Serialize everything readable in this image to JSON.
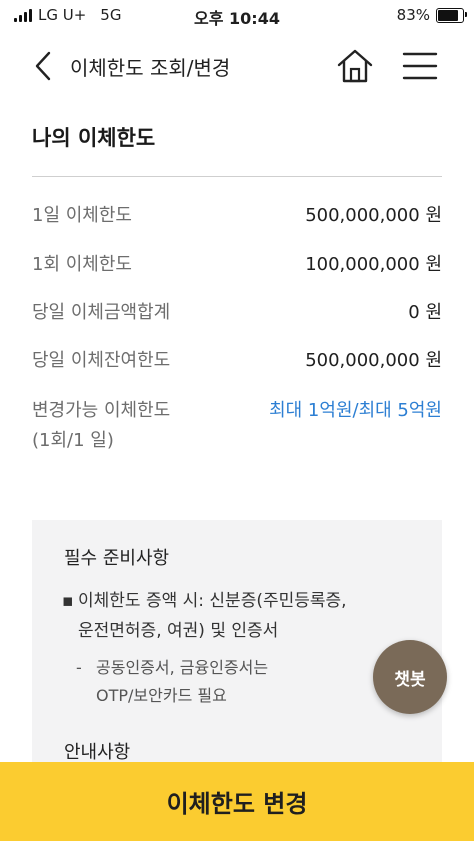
{
  "status_bar": {
    "carrier": "LG U+",
    "network": "5G",
    "time": "오후 10:44",
    "battery": "83%",
    "battery_level": 0.83
  },
  "header": {
    "title": "이체한도 조회/변경",
    "icons": [
      "back-arrow-icon",
      "home-icon",
      "hamburger-menu-icon"
    ]
  },
  "section": {
    "title": "나의 이체한도"
  },
  "rows": [
    {
      "label": "1일 이체한도",
      "value": "500,000,000 원"
    },
    {
      "label": "1회 이체한도",
      "value": "100,000,000 원"
    },
    {
      "label": "당일 이체금액합계",
      "value": "0 원"
    },
    {
      "label": "당일 이체잔여한도",
      "value": "500,000,000 원"
    }
  ],
  "changeable": {
    "label_line1": "변경가능 이체한도",
    "label_line2": "(1회/1 일)",
    "value": "최대 1억원/최대 5억원"
  },
  "notice": {
    "title": "필수 준비사항",
    "bullet_line1": "이체한도 증액 시: 신분증(주민등록증,",
    "bullet_line2": "운전면허증, 여권) 및 인증서",
    "sub_line1": "공동인증서, 금융인증서는",
    "sub_line2": "OTP/보안카드 필요",
    "title2": "안내사항"
  },
  "chatbot": {
    "label": "챗봇"
  },
  "cta": {
    "label": "이체한도 변경"
  },
  "colors": {
    "accent": "#fbcc30",
    "link": "#2d7fd3",
    "chatbot": "#7a6a58"
  }
}
